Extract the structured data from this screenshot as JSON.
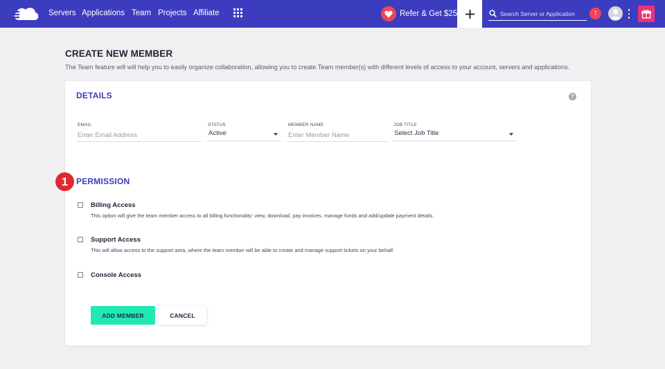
{
  "navbar": {
    "links": [
      "Servers",
      "Applications",
      "Team",
      "Projects",
      "Affiliate"
    ],
    "refer_label": "Refer & Get $25",
    "search_placeholder": "Search Server or Application",
    "notification_count": "7",
    "icons": {
      "logo": "cloud-logo-icon",
      "apps_grid": "grid-icon",
      "refer": "heart-icon",
      "add": "plus-icon",
      "search": "search-icon",
      "avatar": "user-avatar-icon",
      "more": "kebab-menu-icon",
      "gift": "gift-icon"
    },
    "colors": {
      "bar": "#3c3cbf",
      "accent_red": "#f0445a",
      "gift": "#e8327a"
    }
  },
  "page": {
    "title": "CREATE NEW MEMBER",
    "description": "The Team feature will will help you to easily organize collaboration, allowing you to create Team member(s) with different levels of access to your account, servers and applications."
  },
  "details": {
    "title": "DETAILS",
    "help_icon": "?",
    "email": {
      "label": "EMAIL",
      "placeholder": "Enter Email Address"
    },
    "status": {
      "label": "STATUS",
      "value": "Active"
    },
    "member_name": {
      "label": "MEMBER NAME",
      "placeholder": "Enter Member Name"
    },
    "job_title": {
      "label": "JOB TITLE",
      "value": "Select Job Title"
    }
  },
  "permission": {
    "step": "1",
    "title": "PERMISSION",
    "items": [
      {
        "title": "Billing Access",
        "description": "This option will give the team member access to all billing functionality: view, download, pay invoices, manage funds and add/update payment details.",
        "checked": false
      },
      {
        "title": "Support Access",
        "description": "This will allow access to the support area, where the team member will be able to create and manage support tickets on your behalf.",
        "checked": false
      },
      {
        "title": "Console Access",
        "description": "",
        "checked": false
      }
    ]
  },
  "actions": {
    "add_label": "ADD MEMBER",
    "cancel_label": "CANCEL",
    "add_color": "#23e8b3"
  }
}
